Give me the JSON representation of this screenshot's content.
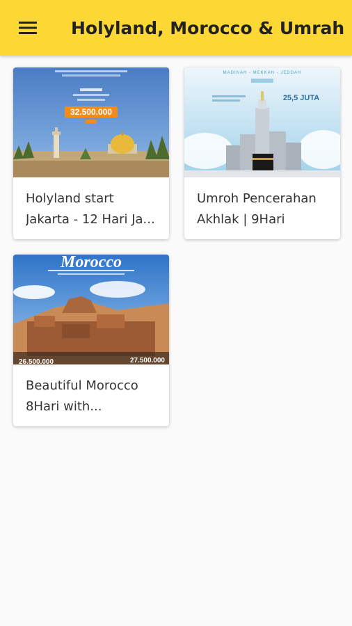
{
  "appbar": {
    "title": "Holyland, Morocco & Umrah",
    "menu_icon": "hamburger-menu-icon",
    "background": "#fdd835"
  },
  "packages": [
    {
      "line1": "Holyland start",
      "line2": "Jakarta - 12 Hari Ja...",
      "price": "32.500.000"
    },
    {
      "line1": "Umroh Pencerahan",
      "line2": "Akhlak | 9Hari",
      "banner": "MADINAH - MEKKAH - JEDDAH",
      "price": "25,5 JUTA"
    },
    {
      "line1": "Beautiful Morocco",
      "line2": "8Hari with...",
      "banner": "Morocco",
      "price_left": "26.500.000",
      "price_right": "27.500.000"
    }
  ]
}
